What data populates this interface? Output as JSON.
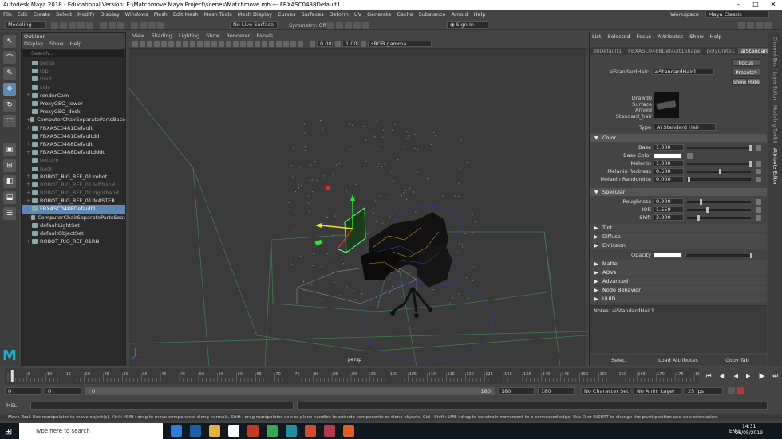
{
  "window": {
    "title": "Autodesk Maya 2018 - Educational Version: E:\\Matchmove Maya Project\\scenes\\Matchmove.mb  ---  FBXASC0488Default1",
    "controls": [
      "–",
      "□",
      "✕"
    ]
  },
  "menubar": {
    "items": [
      "File",
      "Edit",
      "Create",
      "Select",
      "Modify",
      "Display",
      "Windows",
      "Mesh",
      "Edit Mesh",
      "Mesh Tools",
      "Mesh Display",
      "Curves",
      "Surfaces",
      "Deform",
      "UV",
      "Generate",
      "Cache",
      "Substance",
      "Arnold",
      "Help"
    ],
    "workspace_label": "Workspace :",
    "workspace_value": "Maya Classic"
  },
  "statusline": {
    "mode": "Modeling",
    "live_surface": "No Live Surface",
    "symmetry": "Symmetry: Off",
    "sign_in": "Sign In"
  },
  "outliner": {
    "title": "Outliner",
    "menu": [
      "Display",
      "Show",
      "Help"
    ],
    "search_placeholder": "Search...",
    "items": [
      {
        "label": "persp",
        "dim": true,
        "exp": ""
      },
      {
        "label": "top",
        "dim": true,
        "exp": ""
      },
      {
        "label": "front",
        "dim": true,
        "exp": ""
      },
      {
        "label": "side",
        "dim": true,
        "exp": ""
      },
      {
        "label": "renderCam",
        "dim": false,
        "exp": "+"
      },
      {
        "label": "ProxyGEO_tower",
        "dim": false,
        "exp": ""
      },
      {
        "label": "ProxyGEO_desk",
        "dim": false,
        "exp": ""
      },
      {
        "label": "ComputerChairSeparatePartsBase",
        "dim": false,
        "exp": "+"
      },
      {
        "label": "FBXASC0481Default",
        "dim": false,
        "exp": "+"
      },
      {
        "label": "FBXASC0481Defaultdd",
        "dim": false,
        "exp": ""
      },
      {
        "label": "FBXASC0488Default",
        "dim": false,
        "exp": "+"
      },
      {
        "label": "FBXASC0488Defaultdddd",
        "dim": false,
        "exp": "+"
      },
      {
        "label": "bottom",
        "dim": true,
        "exp": ""
      },
      {
        "label": "back",
        "dim": true,
        "exp": ""
      },
      {
        "label": "ROBOT_RIG_REF_01:robot",
        "dim": false,
        "exp": "+"
      },
      {
        "label": "ROBOT_RIG_REF_01:lefthand",
        "dim": true,
        "exp": "+"
      },
      {
        "label": "ROBOT_RIG_REF_01:righthand",
        "dim": true,
        "exp": "+"
      },
      {
        "label": "ROBOT_RIG_REF_01:MASTER",
        "dim": false,
        "exp": "+"
      },
      {
        "label": "FBXASC0488Default1",
        "dim": false,
        "exp": "",
        "selected": true
      },
      {
        "label": "ComputerChairSeparatePartsSeat",
        "dim": false,
        "exp": ""
      },
      {
        "label": "defaultLightSet",
        "dim": false,
        "exp": ""
      },
      {
        "label": "defaultObjectSet",
        "dim": false,
        "exp": ""
      },
      {
        "label": "ROBOT_RIG_REF_01RN",
        "dim": false,
        "exp": "+"
      }
    ]
  },
  "viewport": {
    "menu": [
      "View",
      "Shading",
      "Lighting",
      "Show",
      "Renderer",
      "Panels"
    ],
    "exposure": "0.00",
    "gamma": "1.00",
    "color_space": "sRGB gamma",
    "camera_label": "persp"
  },
  "attribute_editor": {
    "menu": [
      "List",
      "Selected",
      "Focus",
      "Attributes",
      "Show",
      "Help"
    ],
    "tabs": [
      "38Default1",
      "FBXASC0488Default1Shape",
      "polyUnite1",
      "aiStandardHair1"
    ],
    "active_tab": "aiStandardHair1",
    "node_label": "aiStandardHair:",
    "node_value": "aiStandardHair1",
    "buttons": {
      "focus": "Focus",
      "presets": "Presets*",
      "show": "Show",
      "hide": "Hide"
    },
    "swatch_labels": [
      "Drawdb",
      "Surface",
      "Arnold",
      "Standard_hair"
    ],
    "type_label": "Type",
    "type_value": "Ai Standard Hair",
    "color_section": "Color",
    "color_rows": [
      {
        "label": "Base",
        "value": "1.000",
        "fraction": 1.0
      },
      {
        "label": "Base Color",
        "value": "",
        "swatch": "#ffffff"
      },
      {
        "label": "Melanin",
        "value": "1.000",
        "fraction": 1.0
      },
      {
        "label": "Melanin Redness",
        "value": "0.500",
        "fraction": 0.5
      },
      {
        "label": "Melanin Randomize",
        "value": "0.000",
        "fraction": 0.0
      }
    ],
    "specular_section": "Specular",
    "specular_rows": [
      {
        "label": "Roughness",
        "value": "0.200",
        "fraction": 0.2
      },
      {
        "label": "IOR",
        "value": "1.550",
        "fraction": 0.3
      },
      {
        "label": "Shift",
        "value": "3.000",
        "fraction": 0.15
      }
    ],
    "tint_section": "Tint",
    "diffuse_section": "Diffuse",
    "emission_section": "Emission",
    "opacity_label": "Opacity",
    "closed_sections": [
      "Matte",
      "AOVs",
      "Advanced",
      "Node Behavior",
      "UUID"
    ],
    "notes_label": "Notes: aiStandardHair1",
    "bottom_buttons": [
      "Select",
      "Load Attributes",
      "Copy Tab"
    ]
  },
  "side_tabs": [
    "Channel Box / Layer Editor",
    "Modeling Toolkit",
    "Attribute Editor"
  ],
  "timeline": {
    "ticks": [
      "5",
      "10",
      "15",
      "20",
      "25",
      "30",
      "35",
      "40",
      "45",
      "50",
      "55",
      "60",
      "65",
      "70",
      "75",
      "80",
      "85",
      "90",
      "95",
      "100",
      "105",
      "110",
      "115",
      "120",
      "125",
      "130",
      "135",
      "140",
      "145",
      "150",
      "155",
      "160",
      "165",
      "170",
      "175",
      "180"
    ],
    "current_frame": "1"
  },
  "range": {
    "start": "0",
    "min": "0",
    "slider_start": "0",
    "slider_end": "180",
    "end": "180",
    "max": "180",
    "character_set": "No Character Set",
    "anim_layer": "No Anim Layer",
    "fps": "25 fps"
  },
  "mel": {
    "label": "MEL"
  },
  "helpline": "Move Tool: Use manipulator to move object(s). Ctrl+MMB+drag to move components along normals. Shift+drag manipulator axis or plane handles to extrude components or clone objects. Ctrl+Shift+LMB+drag to constrain movement to a connected edge. Use D or INSERT to change the pivot position and axis orientation.",
  "taskbar": {
    "search_placeholder": "Type here to search",
    "time": "14:31",
    "date": "28/05/2019",
    "lang": "ENG",
    "app_colors": [
      "#2d7fd3",
      "#1e5fa8",
      "#e3b23c",
      "#ffffff",
      "#c23b22",
      "#34a853",
      "#1f8f9f",
      "#d04c2b",
      "#b23a4a",
      "#e06020"
    ]
  }
}
